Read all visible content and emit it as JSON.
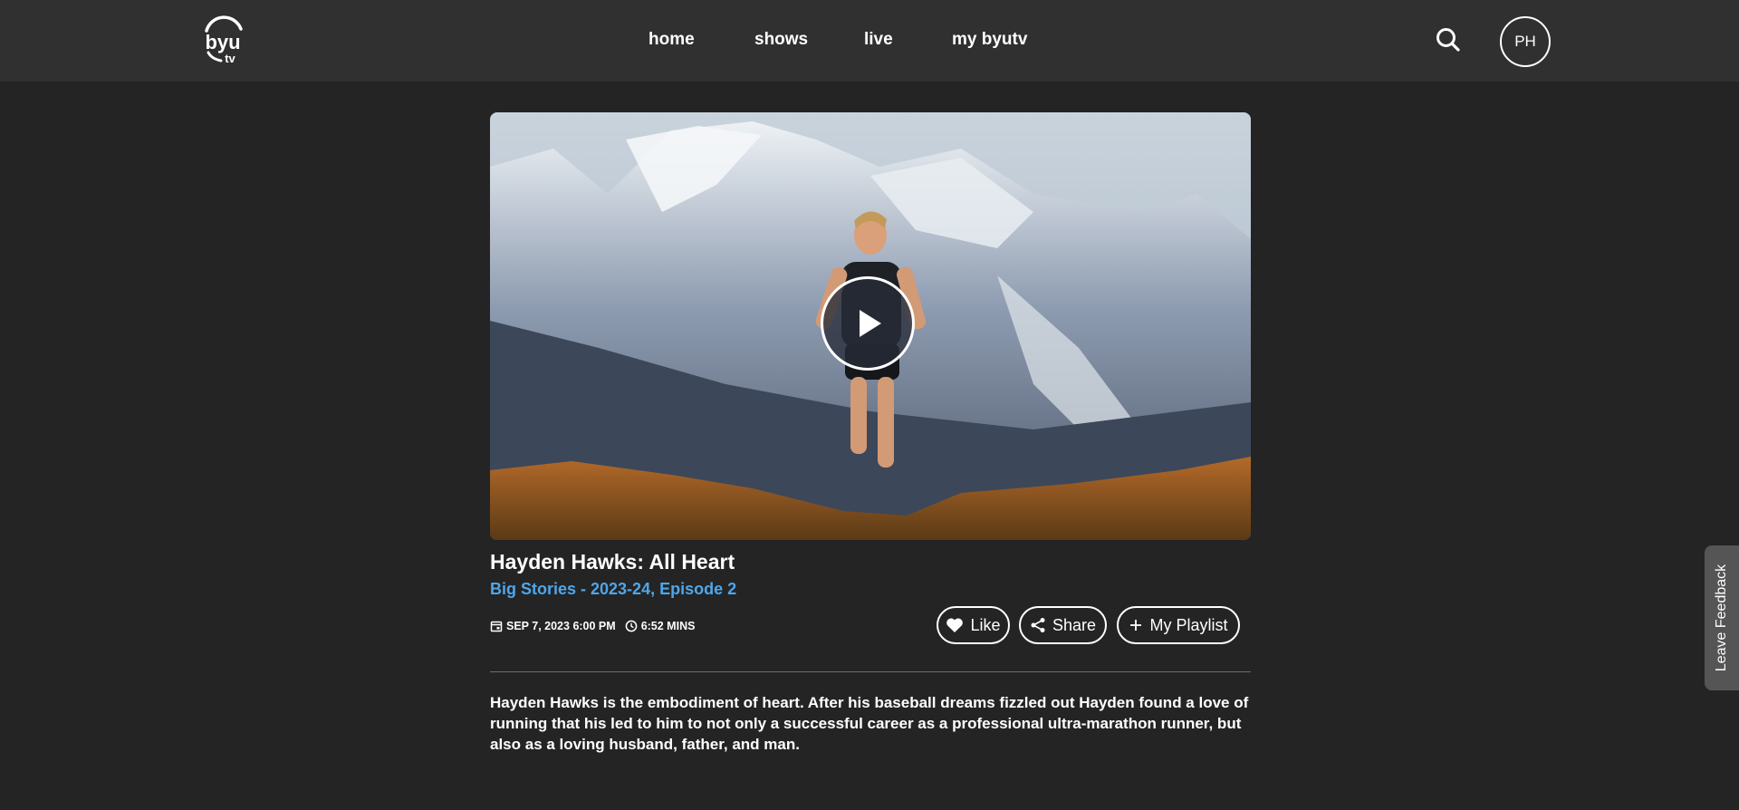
{
  "header": {
    "logo_text_top": "byu",
    "logo_text_bottom": "tv",
    "nav": [
      {
        "label": "home"
      },
      {
        "label": "shows"
      },
      {
        "label": "live"
      },
      {
        "label": "my byutv"
      }
    ],
    "search_icon": "search-icon",
    "avatar_initials": "PH"
  },
  "player": {
    "thumbnail_subject": "trail runner in front of snowy mountains",
    "play_icon": "play-icon"
  },
  "episode": {
    "title": "Hayden Hawks: All Heart",
    "subtitle": "Big Stories - 2023-24, Episode 2",
    "date": "SEP 7, 2023 6:00 PM",
    "duration": "6:52 MINS",
    "date_icon": "calendar-icon",
    "duration_icon": "clock-icon"
  },
  "actions": {
    "like_label": "Like",
    "share_label": "Share",
    "playlist_label": "My Playlist",
    "like_icon": "heart-icon",
    "share_icon": "share-icon",
    "playlist_icon": "plus-icon"
  },
  "description": "Hayden Hawks is the embodiment of heart. After his baseball dreams fizzled out Hayden found a love of running that his led to him to not only a successful career as a professional ultra-marathon runner, but also as a loving husband, father, and man.",
  "feedback": {
    "label": "Leave Feedback"
  },
  "colors": {
    "background": "#242424",
    "header": "#303030",
    "accent_link": "#4fa6ea",
    "feedback_tab": "#555555"
  }
}
